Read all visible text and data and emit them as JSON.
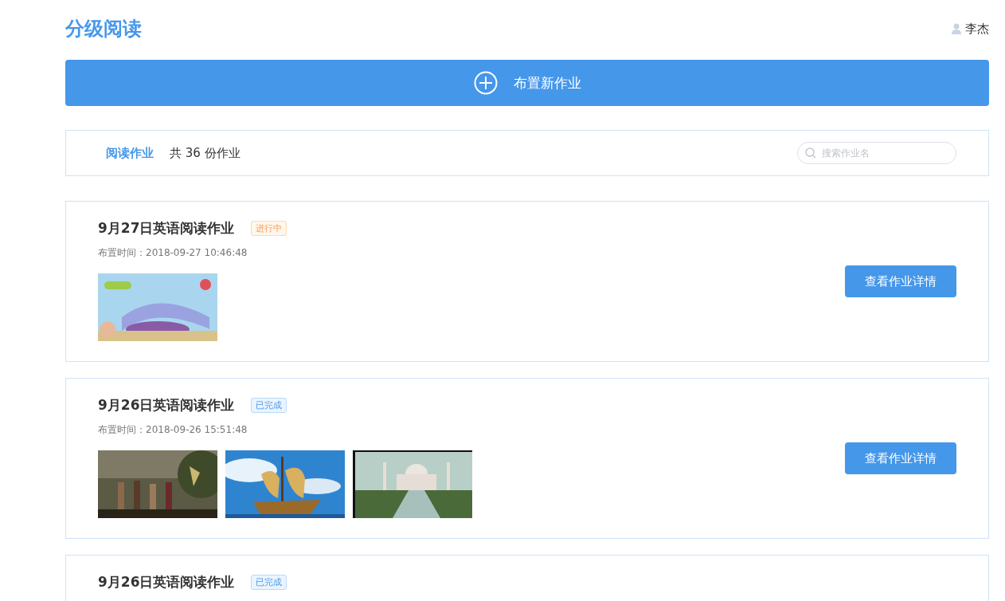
{
  "header": {
    "title": "分级阅读",
    "user": "李杰"
  },
  "new_button": {
    "label": "布置新作业"
  },
  "filter_bar": {
    "tab": "阅读作业",
    "count": "共 36 份作业",
    "search": {
      "placeholder": "搜索作业名"
    }
  },
  "assignments": [
    {
      "title": "9月27日英语阅读作业",
      "status": {
        "label": "进行中",
        "kind": "in_progress"
      },
      "time": "布置时间：2018-09-27 10:46:48",
      "button": "查看作业详情"
    },
    {
      "title": "9月26日英语阅读作业",
      "status": {
        "label": "已完成",
        "kind": "done"
      },
      "time": "布置时间：2018-09-26 15:51:48",
      "button": "查看作业详情"
    },
    {
      "title": "9月26日英语阅读作业",
      "status": {
        "label": "已完成",
        "kind": "done"
      }
    }
  ]
}
